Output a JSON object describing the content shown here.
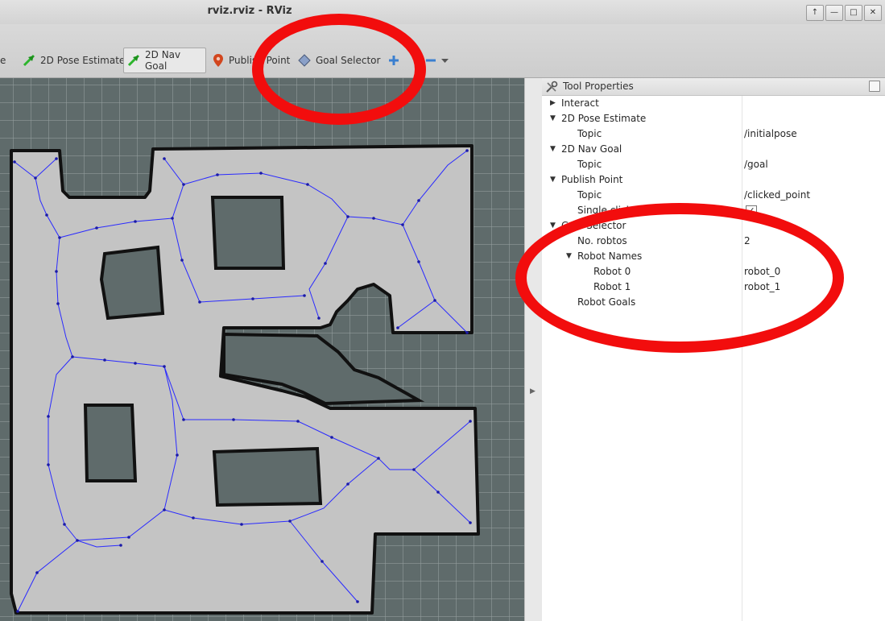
{
  "window": {
    "title": "rviz.rviz - RViz",
    "controls": [
      "↑",
      "—",
      "□",
      "✕"
    ]
  },
  "toolbar": {
    "cut_label": "e",
    "items": [
      {
        "label": "2D Pose Estimate",
        "icon": "green-arrow-icon"
      },
      {
        "label": "2D Nav Goal",
        "icon": "green-arrow-icon",
        "active": true
      },
      {
        "label": "Publish Point",
        "icon": "map-pin-icon"
      },
      {
        "label": "Goal  Selector",
        "icon": "diamond-icon"
      },
      {
        "label": "",
        "icon": "plus-icon"
      },
      {
        "label": "",
        "icon": "minus-icon"
      }
    ]
  },
  "panel": {
    "title": "Tool Properties",
    "rows": [
      {
        "name": "Interact",
        "value": "",
        "expanded": false
      },
      {
        "name": "2D Pose Estimate",
        "value": "",
        "expanded": true
      },
      {
        "name": "Topic",
        "value": "/initialpose"
      },
      {
        "name": "2D Nav Goal",
        "value": "",
        "expanded": true
      },
      {
        "name": "Topic",
        "value": "/goal"
      },
      {
        "name": "Publish Point",
        "value": "",
        "expanded": true
      },
      {
        "name": "Topic",
        "value": "/clicked_point"
      },
      {
        "name": "Single click",
        "value": "",
        "checked": true
      },
      {
        "name": "Goal Selector",
        "value": "",
        "expanded": true
      },
      {
        "name": "No. robtos",
        "value": "2"
      },
      {
        "name": "Robot Names",
        "value": "",
        "expanded": true
      },
      {
        "name": "Robot 0",
        "value": "robot_0"
      },
      {
        "name": "Robot 1",
        "value": "robot_1"
      },
      {
        "name": "Robot Goals",
        "value": ""
      }
    ]
  },
  "colors": {
    "annotation": "#f20d0d",
    "map_free": "#c4c4c4",
    "map_unknown": "#5f6b6b",
    "graph_edges": "#2a2aff"
  }
}
